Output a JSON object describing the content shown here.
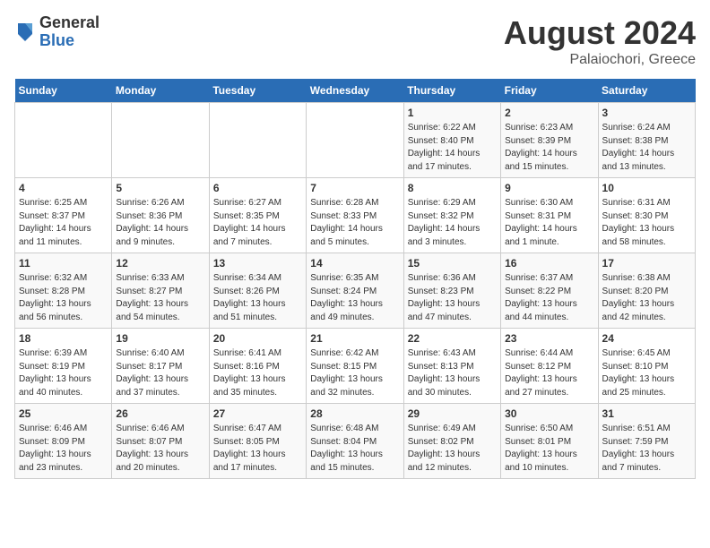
{
  "logo": {
    "general": "General",
    "blue": "Blue"
  },
  "title": {
    "month_year": "August 2024",
    "location": "Palaiochori, Greece"
  },
  "weekdays": [
    "Sunday",
    "Monday",
    "Tuesday",
    "Wednesday",
    "Thursday",
    "Friday",
    "Saturday"
  ],
  "weeks": [
    [
      {
        "day": "",
        "info": ""
      },
      {
        "day": "",
        "info": ""
      },
      {
        "day": "",
        "info": ""
      },
      {
        "day": "",
        "info": ""
      },
      {
        "day": "1",
        "info": "Sunrise: 6:22 AM\nSunset: 8:40 PM\nDaylight: 14 hours and 17 minutes."
      },
      {
        "day": "2",
        "info": "Sunrise: 6:23 AM\nSunset: 8:39 PM\nDaylight: 14 hours and 15 minutes."
      },
      {
        "day": "3",
        "info": "Sunrise: 6:24 AM\nSunset: 8:38 PM\nDaylight: 14 hours and 13 minutes."
      }
    ],
    [
      {
        "day": "4",
        "info": "Sunrise: 6:25 AM\nSunset: 8:37 PM\nDaylight: 14 hours and 11 minutes."
      },
      {
        "day": "5",
        "info": "Sunrise: 6:26 AM\nSunset: 8:36 PM\nDaylight: 14 hours and 9 minutes."
      },
      {
        "day": "6",
        "info": "Sunrise: 6:27 AM\nSunset: 8:35 PM\nDaylight: 14 hours and 7 minutes."
      },
      {
        "day": "7",
        "info": "Sunrise: 6:28 AM\nSunset: 8:33 PM\nDaylight: 14 hours and 5 minutes."
      },
      {
        "day": "8",
        "info": "Sunrise: 6:29 AM\nSunset: 8:32 PM\nDaylight: 14 hours and 3 minutes."
      },
      {
        "day": "9",
        "info": "Sunrise: 6:30 AM\nSunset: 8:31 PM\nDaylight: 14 hours and 1 minute."
      },
      {
        "day": "10",
        "info": "Sunrise: 6:31 AM\nSunset: 8:30 PM\nDaylight: 13 hours and 58 minutes."
      }
    ],
    [
      {
        "day": "11",
        "info": "Sunrise: 6:32 AM\nSunset: 8:28 PM\nDaylight: 13 hours and 56 minutes."
      },
      {
        "day": "12",
        "info": "Sunrise: 6:33 AM\nSunset: 8:27 PM\nDaylight: 13 hours and 54 minutes."
      },
      {
        "day": "13",
        "info": "Sunrise: 6:34 AM\nSunset: 8:26 PM\nDaylight: 13 hours and 51 minutes."
      },
      {
        "day": "14",
        "info": "Sunrise: 6:35 AM\nSunset: 8:24 PM\nDaylight: 13 hours and 49 minutes."
      },
      {
        "day": "15",
        "info": "Sunrise: 6:36 AM\nSunset: 8:23 PM\nDaylight: 13 hours and 47 minutes."
      },
      {
        "day": "16",
        "info": "Sunrise: 6:37 AM\nSunset: 8:22 PM\nDaylight: 13 hours and 44 minutes."
      },
      {
        "day": "17",
        "info": "Sunrise: 6:38 AM\nSunset: 8:20 PM\nDaylight: 13 hours and 42 minutes."
      }
    ],
    [
      {
        "day": "18",
        "info": "Sunrise: 6:39 AM\nSunset: 8:19 PM\nDaylight: 13 hours and 40 minutes."
      },
      {
        "day": "19",
        "info": "Sunrise: 6:40 AM\nSunset: 8:17 PM\nDaylight: 13 hours and 37 minutes."
      },
      {
        "day": "20",
        "info": "Sunrise: 6:41 AM\nSunset: 8:16 PM\nDaylight: 13 hours and 35 minutes."
      },
      {
        "day": "21",
        "info": "Sunrise: 6:42 AM\nSunset: 8:15 PM\nDaylight: 13 hours and 32 minutes."
      },
      {
        "day": "22",
        "info": "Sunrise: 6:43 AM\nSunset: 8:13 PM\nDaylight: 13 hours and 30 minutes."
      },
      {
        "day": "23",
        "info": "Sunrise: 6:44 AM\nSunset: 8:12 PM\nDaylight: 13 hours and 27 minutes."
      },
      {
        "day": "24",
        "info": "Sunrise: 6:45 AM\nSunset: 8:10 PM\nDaylight: 13 hours and 25 minutes."
      }
    ],
    [
      {
        "day": "25",
        "info": "Sunrise: 6:46 AM\nSunset: 8:09 PM\nDaylight: 13 hours and 23 minutes."
      },
      {
        "day": "26",
        "info": "Sunrise: 6:46 AM\nSunset: 8:07 PM\nDaylight: 13 hours and 20 minutes."
      },
      {
        "day": "27",
        "info": "Sunrise: 6:47 AM\nSunset: 8:05 PM\nDaylight: 13 hours and 17 minutes."
      },
      {
        "day": "28",
        "info": "Sunrise: 6:48 AM\nSunset: 8:04 PM\nDaylight: 13 hours and 15 minutes."
      },
      {
        "day": "29",
        "info": "Sunrise: 6:49 AM\nSunset: 8:02 PM\nDaylight: 13 hours and 12 minutes."
      },
      {
        "day": "30",
        "info": "Sunrise: 6:50 AM\nSunset: 8:01 PM\nDaylight: 13 hours and 10 minutes."
      },
      {
        "day": "31",
        "info": "Sunrise: 6:51 AM\nSunset: 7:59 PM\nDaylight: 13 hours and 7 minutes."
      }
    ]
  ]
}
